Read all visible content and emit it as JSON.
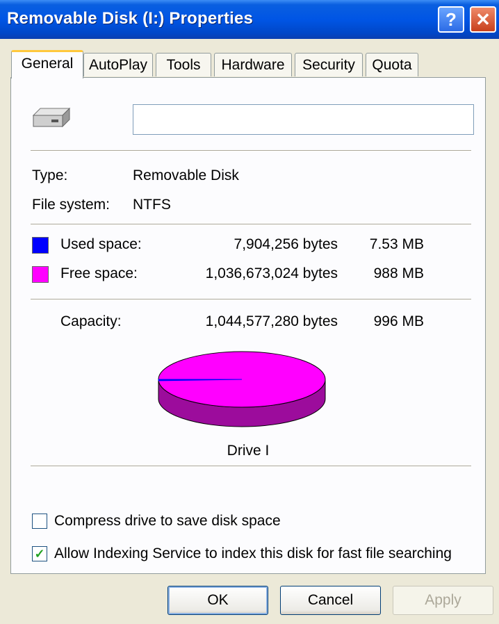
{
  "window": {
    "title": "Removable Disk (I:) Properties",
    "help_button": "?",
    "close_button": "✕"
  },
  "tabs": [
    {
      "label": "General",
      "active": true
    },
    {
      "label": "AutoPlay"
    },
    {
      "label": "Tools"
    },
    {
      "label": "Hardware"
    },
    {
      "label": "Security"
    },
    {
      "label": "Quota"
    }
  ],
  "general": {
    "volume_label_value": "",
    "type_label": "Type:",
    "type_value": "Removable Disk",
    "fs_label": "File system:",
    "fs_value": "NTFS",
    "used_label": "Used space:",
    "used_bytes": "7,904,256 bytes",
    "used_size": "7.53 MB",
    "free_label": "Free space:",
    "free_bytes": "1,036,673,024 bytes",
    "free_size": "988 MB",
    "capacity_label": "Capacity:",
    "capacity_bytes": "1,044,577,280 bytes",
    "capacity_size": "996 MB",
    "drive_caption": "Drive I",
    "compress_label": "Compress drive to save disk space",
    "compress_checked": false,
    "index_label": "Allow Indexing Service to index this disk for fast file searching",
    "index_checked": true
  },
  "colors": {
    "used": "#0000ff",
    "free": "#ff00ff",
    "free_side": "#9c0c9c"
  },
  "chart_data": {
    "type": "pie",
    "categories": [
      "Used space",
      "Free space"
    ],
    "values": [
      7904256,
      1036673024
    ]
  },
  "buttons": {
    "ok": "OK",
    "cancel": "Cancel",
    "apply": "Apply"
  }
}
